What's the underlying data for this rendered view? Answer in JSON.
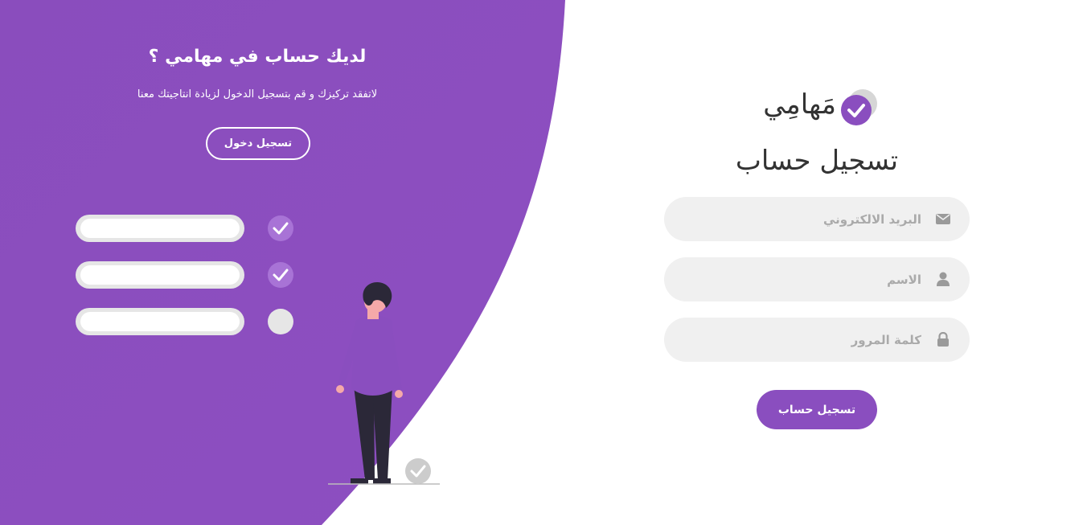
{
  "colors": {
    "accent": "#8a4ebf",
    "field_bg": "#f0f0f0",
    "text_dark": "#333333"
  },
  "left_panel": {
    "title": "لديك حساب في مهامي ؟",
    "subtitle": "لاتفقد تركيزك و قم بتسجيل الدخول لزيادة انتاجيتك معنا",
    "login_button": "تسجيل دخول",
    "checklist": [
      {
        "checked": true
      },
      {
        "checked": true
      },
      {
        "checked": false
      }
    ]
  },
  "brand": {
    "name": "مَهامِي",
    "icon": "check-circle-icon"
  },
  "form": {
    "title": "تسجيل حساب",
    "fields": [
      {
        "placeholder": "البريد الالكتروني",
        "icon": "envelope-icon",
        "value": ""
      },
      {
        "placeholder": "الاسم",
        "icon": "user-icon",
        "value": ""
      },
      {
        "placeholder": "كلمة المرور",
        "icon": "lock-icon",
        "value": ""
      }
    ],
    "submit_label": "تسجيل حساب"
  }
}
